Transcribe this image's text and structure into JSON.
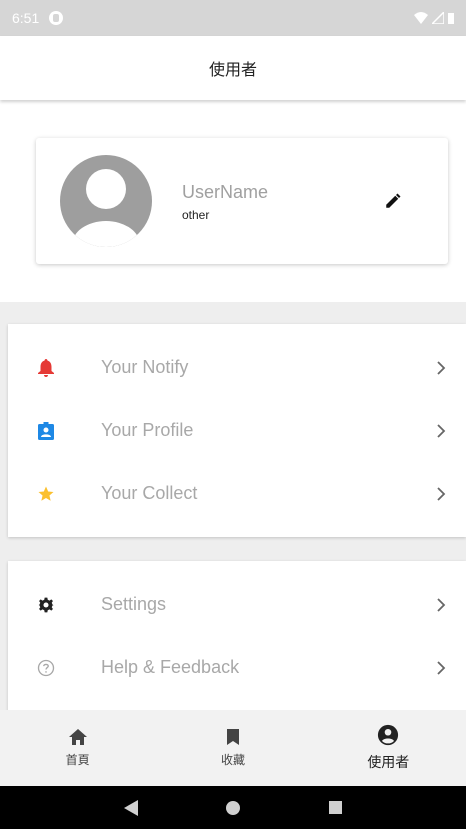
{
  "status_bar": {
    "time": "6:51"
  },
  "app_bar": {
    "title": "使用者"
  },
  "profile": {
    "username": "UserName",
    "subtitle": "other"
  },
  "menu_group_1": [
    {
      "label": "Your Notify",
      "icon": "bell-icon",
      "color": "#e53935"
    },
    {
      "label": "Your Profile",
      "icon": "badge-icon",
      "color": "#1e88e5"
    },
    {
      "label": "Your Collect",
      "icon": "star-icon",
      "color": "#fbc02d"
    }
  ],
  "menu_group_2": [
    {
      "label": "Settings",
      "icon": "gear-icon",
      "color": "#222222"
    },
    {
      "label": "Help & Feedback",
      "icon": "help-icon",
      "color": "#a8a8a8"
    }
  ],
  "bottom_nav": {
    "home_label": "首頁",
    "collect_label": "收藏",
    "user_label": "使用者"
  },
  "colors": {
    "status_bar": "#d6d6d6",
    "nav_bg": "#f2f2f2",
    "avatar": "#9e9e9e"
  }
}
